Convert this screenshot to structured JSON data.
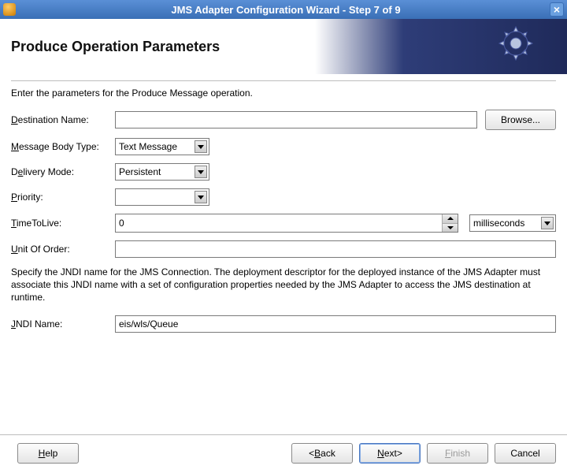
{
  "window": {
    "title": "JMS Adapter Configuration Wizard - Step 7 of 9"
  },
  "header": {
    "heading": "Produce Operation Parameters"
  },
  "intro": "Enter the parameters for the Produce Message operation.",
  "form": {
    "destination": {
      "label_pre": "D",
      "label_rest": "estination Name:",
      "value": "",
      "browse": "Browse..."
    },
    "bodyType": {
      "label_pre": "M",
      "label_rest": "essage Body Type:",
      "selected": "Text Message"
    },
    "delivery": {
      "label_pre": "",
      "label_plain": "D",
      "label_rest_u": "e",
      "label_rest2": "livery Mode:",
      "selected": "Persistent"
    },
    "priority": {
      "label_pre": "P",
      "label_rest": "riority:",
      "selected": ""
    },
    "ttl": {
      "label_pre": "T",
      "label_rest": "imeToLive:",
      "value": "0",
      "unit": "milliseconds"
    },
    "unitOrder": {
      "label_pre": "U",
      "label_rest": "nit Of Order:",
      "value": ""
    },
    "jndiDesc": "Specify the JNDI name for the JMS Connection.  The deployment descriptor for the deployed instance of the JMS Adapter must associate this JNDI name with a set of configuration properties needed by the JMS Adapter to access the JMS destination at runtime.",
    "jndi": {
      "label_pre": "J",
      "label_rest": "NDI Name:",
      "value": "eis/wls/Queue"
    }
  },
  "footer": {
    "help": {
      "pre": "H",
      "rest": "elp"
    },
    "back": {
      "lt": "< ",
      "pre": "B",
      "rest": "ack"
    },
    "next": {
      "pre": "N",
      "rest": "ext",
      "gt": " >"
    },
    "finish": {
      "pre": "F",
      "rest": "inish"
    },
    "cancel": "Cancel"
  }
}
